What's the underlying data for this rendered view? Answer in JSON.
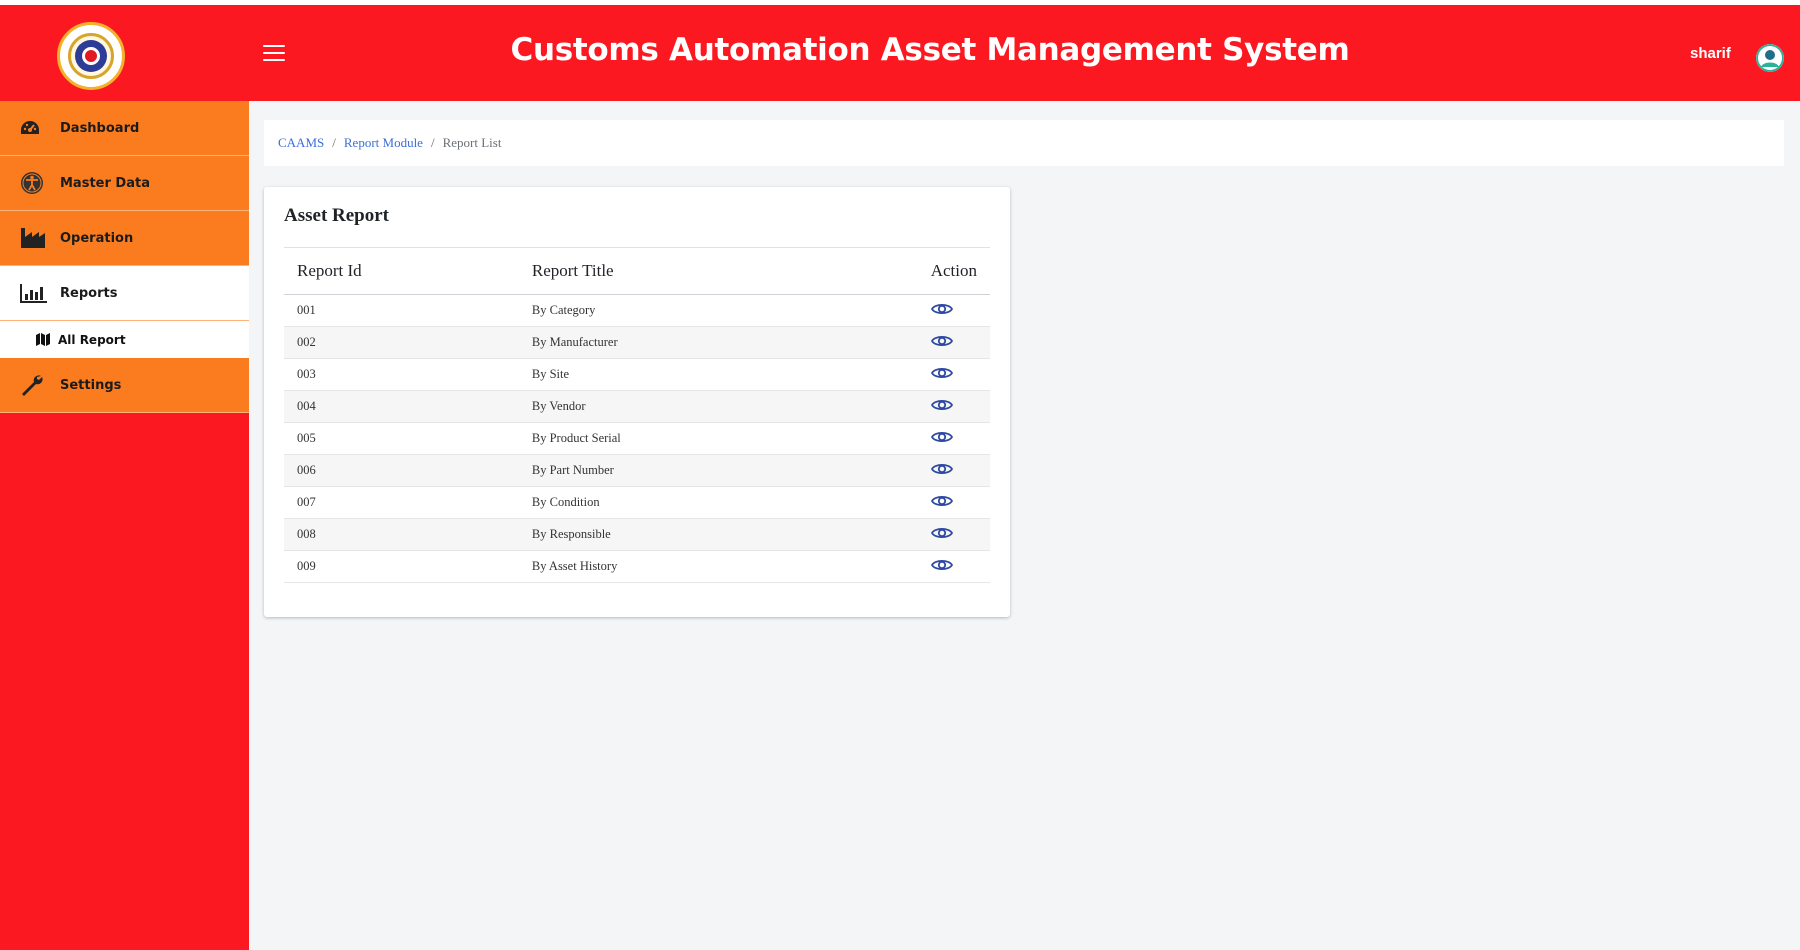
{
  "app": {
    "title": "Customs Automation Asset Management System"
  },
  "user": {
    "name": "sharif"
  },
  "colors": {
    "header": "#fb1820",
    "sidebar_item": "#fb7c1f",
    "link": "#3b6fd8",
    "icon": "#2b4aa0"
  },
  "sidebar": {
    "items": [
      {
        "label": "Dashboard",
        "icon": "dashboard-gauge-icon"
      },
      {
        "label": "Master Data",
        "icon": "accessibility-icon"
      },
      {
        "label": "Operation",
        "icon": "factory-icon"
      },
      {
        "label": "Reports",
        "icon": "bar-chart-icon"
      },
      {
        "label": "Settings",
        "icon": "wrench-icon"
      }
    ],
    "sub_items": [
      {
        "label": "All Report",
        "icon": "map-icon"
      }
    ]
  },
  "breadcrumb": {
    "root": "CAAMS",
    "module": "Report Module",
    "current": "Report List",
    "separator": "/"
  },
  "card": {
    "title": "Asset Report",
    "columns": [
      "Report Id",
      "Report Title",
      "Action"
    ],
    "rows": [
      {
        "id": "001",
        "title": "By Category"
      },
      {
        "id": "002",
        "title": "By Manufacturer"
      },
      {
        "id": "003",
        "title": "By Site"
      },
      {
        "id": "004",
        "title": "By Vendor"
      },
      {
        "id": "005",
        "title": "By Product Serial"
      },
      {
        "id": "006",
        "title": "By Part Number"
      },
      {
        "id": "007",
        "title": "By Condition"
      },
      {
        "id": "008",
        "title": "By Responsible"
      },
      {
        "id": "009",
        "title": "By Asset History"
      }
    ]
  }
}
